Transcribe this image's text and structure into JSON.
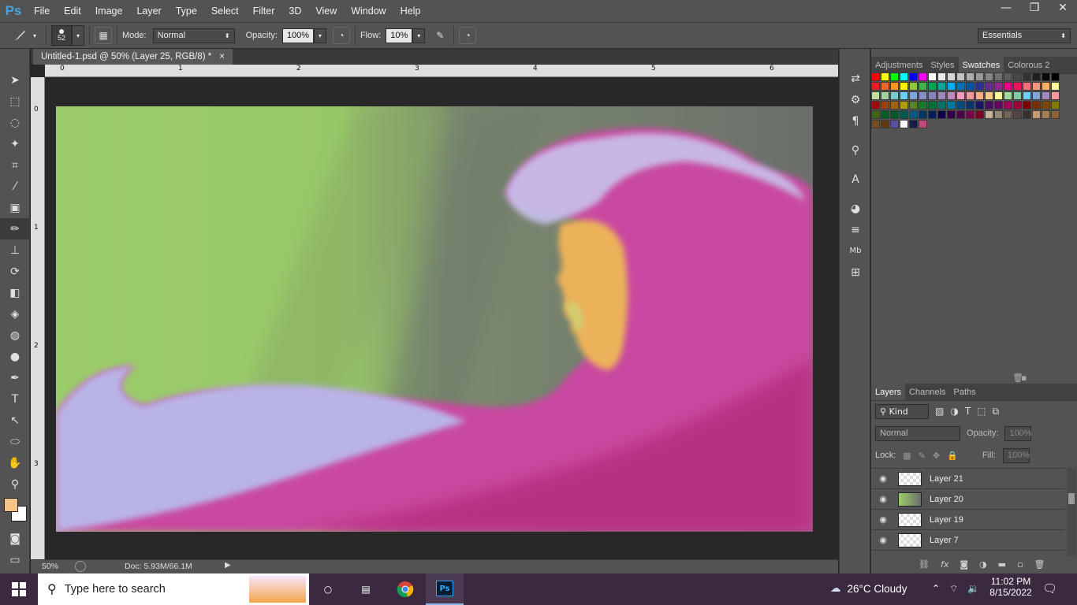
{
  "app": {
    "logo": "Ps"
  },
  "menu": [
    "File",
    "Edit",
    "Image",
    "Layer",
    "Type",
    "Select",
    "Filter",
    "3D",
    "View",
    "Window",
    "Help"
  ],
  "window_controls": {
    "minimize": "—",
    "restore": "❐",
    "close": "✕"
  },
  "options": {
    "brush_size": "52",
    "mode_label": "Mode:",
    "mode_value": "Normal",
    "opacity_label": "Opacity:",
    "opacity_value": "100%",
    "flow_label": "Flow:",
    "flow_value": "10%",
    "workspace": "Essentials"
  },
  "document": {
    "tab_title": "Untitled-1.psd @ 50% (Layer 25, RGB/8) *",
    "close": "×",
    "ruler_top": [
      "0",
      "1",
      "2",
      "3",
      "4",
      "5",
      "6"
    ],
    "ruler_left": [
      "0",
      "1",
      "2",
      "3"
    ]
  },
  "status": {
    "zoom": "50%",
    "doc": "Doc: 5.93M/66.1M"
  },
  "panels": {
    "top_tabs": [
      "Adjustments",
      "Styles",
      "Swatches",
      "Colorous 2"
    ],
    "active_top_tab": "Swatches",
    "layer_tabs": [
      "Layers",
      "Channels",
      "Paths"
    ],
    "filter_kind": "Kind",
    "blend_mode": "Normal",
    "opacity_label": "Opacity:",
    "opacity_value": "100%",
    "lock_label": "Lock:",
    "fill_label": "Fill:",
    "fill_value": "100%",
    "layers": [
      {
        "name": "Layer 21"
      },
      {
        "name": "Layer 20"
      },
      {
        "name": "Layer 19"
      },
      {
        "name": "Layer 7"
      }
    ]
  },
  "colors": {
    "foreground": "#f7c28a",
    "background": "#ffffff",
    "green_bg": "#9ccc6a",
    "gray_bg": "#6b6f6b",
    "hair_pink": "#c94aa0",
    "hair_light": "#b9b4e6",
    "skin": "#ecb25a"
  },
  "swatch_rows": [
    [
      "#ff0000",
      "#ffff00",
      "#00ff00",
      "#00ffff",
      "#0000ff",
      "#ff00ff",
      "#ffffff",
      "#ebebeb",
      "#d6d6d6",
      "#c2c2c2",
      "#adadad",
      "#999999",
      "#858585",
      "#707070",
      "#5c5c5c",
      "#474747",
      "#333333",
      "#1f1f1f",
      "#0a0a0a",
      "#000000"
    ],
    [
      "#ed1c24",
      "#f26522",
      "#f7941d",
      "#fff200",
      "#8dc63f",
      "#39b54a",
      "#00a651",
      "#00a99d",
      "#00aeef",
      "#0072bc",
      "#0054a6",
      "#2e3192",
      "#662d91",
      "#92278f",
      "#ec008c",
      "#ed145b",
      "#f26d7d",
      "#f69679",
      "#fbaf5d",
      "#fff799"
    ],
    [
      "#c4df9b",
      "#a3d39c",
      "#7accc8",
      "#6dcff6",
      "#7da7d9",
      "#8393ca",
      "#8781bd",
      "#a186be",
      "#bd8cbf",
      "#f49ac1",
      "#f5989d",
      "#f9ad81",
      "#fdc68a",
      "#fff79a",
      "#a1d9a0",
      "#82ca9c",
      "#6ecff6",
      "#7fa7d9",
      "#a286be",
      "#f6989d"
    ],
    [
      "#9e0b0f",
      "#a0410d",
      "#a36209",
      "#aba000",
      "#598527",
      "#1a7b30",
      "#007236",
      "#00746b",
      "#0076a3",
      "#004a80",
      "#003471",
      "#1b1464",
      "#440e62",
      "#630460",
      "#9e005d",
      "#9e0039",
      "#790000",
      "#7b2e00",
      "#7d4900",
      "#827b00"
    ],
    [
      "#406618",
      "#005e20",
      "#005826",
      "#005952",
      "#005b7f",
      "#003663",
      "#002157",
      "#0d004c",
      "#32004b",
      "#4b0049",
      "#7b0046",
      "#7a0026",
      "#c7b299",
      "#998675",
      "#736357",
      "#534741",
      "#37302a",
      "#c69c6d",
      "#a67c52",
      "#8c6239"
    ],
    [
      "#754c24",
      "#603813",
      "#5a4fa0",
      "#ffffff",
      "#1a1a4a",
      "#c24a7a"
    ]
  ]
}
